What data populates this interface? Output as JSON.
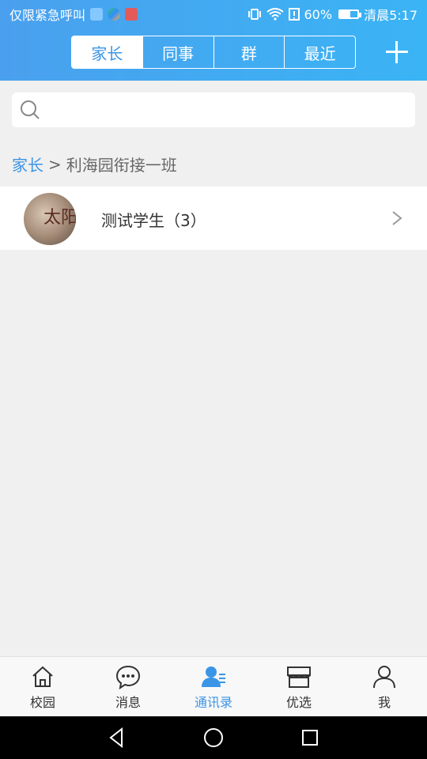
{
  "status_bar": {
    "left_text": "仅限紧急呼叫",
    "battery_percent": "60%",
    "battery_level": 0.6,
    "time": "清晨5:17"
  },
  "tabs": [
    {
      "label": "家长",
      "active": true
    },
    {
      "label": "同事",
      "active": false
    },
    {
      "label": "群",
      "active": false
    },
    {
      "label": "最近",
      "active": false
    }
  ],
  "search": {
    "placeholder": ""
  },
  "breadcrumb": {
    "root": "家长",
    "separator": ">",
    "current": "利海园衔接一班"
  },
  "list": [
    {
      "avatar_text": "太阳",
      "label": "测试学生（3）"
    }
  ],
  "bottom_nav": [
    {
      "label": "校园",
      "icon": "home-icon",
      "active": false
    },
    {
      "label": "消息",
      "icon": "chat-icon",
      "active": false
    },
    {
      "label": "通讯录",
      "icon": "contacts-icon",
      "active": true
    },
    {
      "label": "优选",
      "icon": "store-icon",
      "active": false
    },
    {
      "label": "我",
      "icon": "person-icon",
      "active": false
    }
  ],
  "colors": {
    "accent": "#3b95e6",
    "header_start": "#4aa0ee",
    "header_end": "#3ab4f5"
  }
}
